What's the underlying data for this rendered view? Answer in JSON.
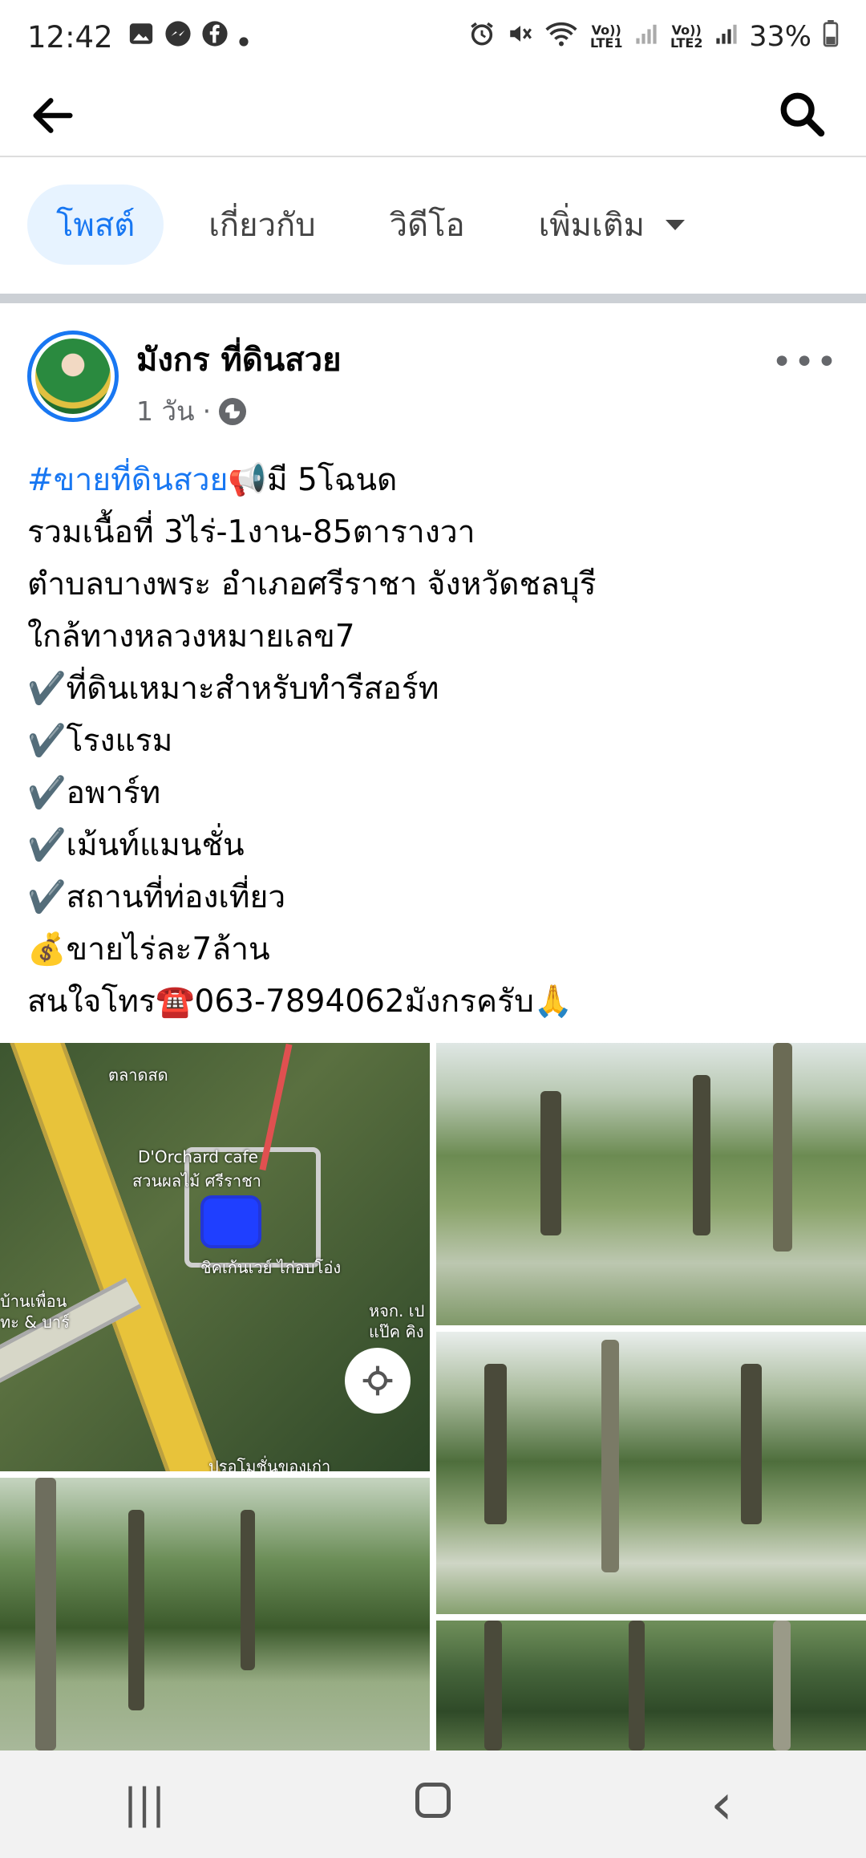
{
  "status_bar": {
    "time": "12:42",
    "left_icons": [
      "gallery-icon",
      "messenger-icon",
      "facebook-icon",
      "dot-icon"
    ],
    "right_icons": [
      "alarm-icon",
      "mute-icon",
      "wifi-icon",
      "signal-icon",
      "signal-icon"
    ],
    "sim1_label": "Vo)) LTE1",
    "sim2_label": "Vo)) LTE2",
    "battery": "33%"
  },
  "app_bar": {
    "back_icon": "back-arrow-icon",
    "search_icon": "search-icon"
  },
  "tabs": [
    {
      "label": "โพสต์",
      "active": true
    },
    {
      "label": "เกี่ยวกับ",
      "active": false
    },
    {
      "label": "วิดีโอ",
      "active": false
    },
    {
      "label": "เพิ่มเติม",
      "active": false
    }
  ],
  "post": {
    "author": "มังกร ที่ดินสวย",
    "time": "1 วัน",
    "separator": "·",
    "privacy_icon": "globe-icon",
    "more_label": "•••",
    "lines": {
      "l1_hashtag": "#ขายที่ดินสวย",
      "l1_rest": "📢มี 5โฉนด",
      "l2": "รวมเนื้อที่ 3ไร่-1งาน-85ตารางวา",
      "l3": "ตำบลบางพระ อำเภอศรีราชา จังหวัดชลบุรี",
      "l4": "ใกล้ทางหลวงหมายเลข7",
      "l5": "✔️ที่ดินเหมาะสำหรับทำรีสอร์ท",
      "l6": "✔️โรงแรม",
      "l7": "✔️อพาร์ท",
      "l8": "✔️เม้นท์แมนชั่น",
      "l9": "✔️สถานที่ท่องเที่ยว",
      "l10": "💰ขายไร่ละ7ล้าน",
      "l11": "สนใจโทร☎️063-7894062มังกรครับ🙏"
    }
  },
  "map": {
    "label_cafe": "D'Orchard cafe",
    "label_garden": "สวนผลไม้ ศรีราชา",
    "label_restaurant": "ชิคเก้นเวย์ ไก่อบโอ่ง",
    "label_friends": "บ้านเพื่อน",
    "label_bar": "ทะ & บาร์",
    "label_shop": "หจก. เป",
    "label_shop2": "แป๊ค คิง",
    "label_top": "ตลาดสด",
    "label_bottom": "ปรอโมชั่นของเก่า",
    "locate_icon": "locate-icon"
  },
  "nav_bar": {
    "recents_icon": "recents-icon",
    "home_icon": "home-icon",
    "back_icon": "back-icon",
    "recents_glyph": "|||",
    "back_glyph": "‹"
  }
}
